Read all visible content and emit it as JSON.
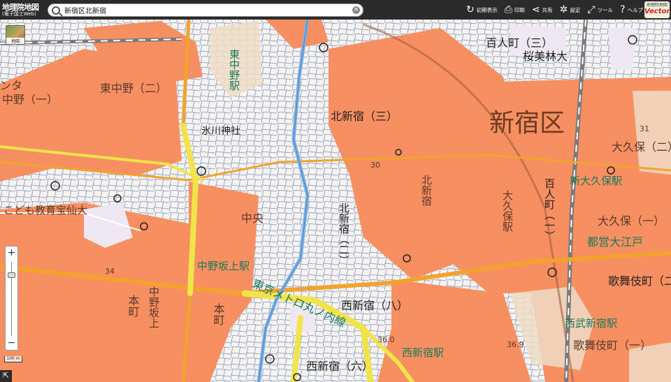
{
  "app": {
    "logo_title": "地理院地図",
    "logo_sub": "(電子国土Web)"
  },
  "search": {
    "value": "新宿区北新宿",
    "clear_label": "×"
  },
  "toolbar": {
    "reset_label": "初期表示",
    "print_label": "印刷",
    "share_label": "共有",
    "settings_label": "設定",
    "tools_label": "ツール",
    "help_label": "ヘルプ",
    "vector_line1": "地理院地図",
    "vector_line2": "Vector"
  },
  "basemap": {
    "label": "地図"
  },
  "zoom": {
    "in_label": "+",
    "out_label": "−",
    "level": 0.85
  },
  "scale": {
    "label": "100 m"
  },
  "colors": {
    "urban_fill": "#f78c5d",
    "road_main": "#f5a623",
    "road_highway": "#f0e44a",
    "river": "#7ab3e6",
    "rail": "#8b8b8b"
  },
  "map_labels": {
    "district": "新宿区",
    "higashinakano_2": "東中野（二）",
    "nakano_1": "中野（一）",
    "kitashinjuku_3": "北新宿（三）",
    "hyakunincho_3": "百人町（三）",
    "okubo_2": "大久保（二）",
    "okubo_1": "大久保（一）",
    "hikawa": "氷川神社",
    "kodomo": "こども教育宝仙大",
    "higashinakano_st": "東中野駅",
    "shinokubo_st": "新大久保駅",
    "sakuranbo": "桜美林大",
    "nakanosakaue_st": "中野坂上駅",
    "tozai": "東京メトロ丸ノ内線",
    "nishishinjuku_8": "西新宿（八）",
    "nishishinjuku_6": "西新宿（六）",
    "nishishinjuku_st": "西新宿駅",
    "seibushinjuku_st": "西武新宿駅",
    "toei": "都営大江戸",
    "kabukicho_2": "歌舞伎町（二）",
    "kabukicho_1": "歌舞伎町（一）",
    "honmachi": "本町",
    "honmachi2": "本町",
    "nakanosakaue": "中野坂上",
    "kitashinjuku_v": "北新宿",
    "kitashinjuku2_v": "北新宿（二）",
    "hyakunincho_v": "百人町（一）",
    "okubo_v": "大久保駅",
    "chuo": "中央",
    "height_30": "30",
    "height_34": "34",
    "height_36": "36.0",
    "height_369": "36.9",
    "height_31": "31",
    "nta": "ンタ"
  }
}
